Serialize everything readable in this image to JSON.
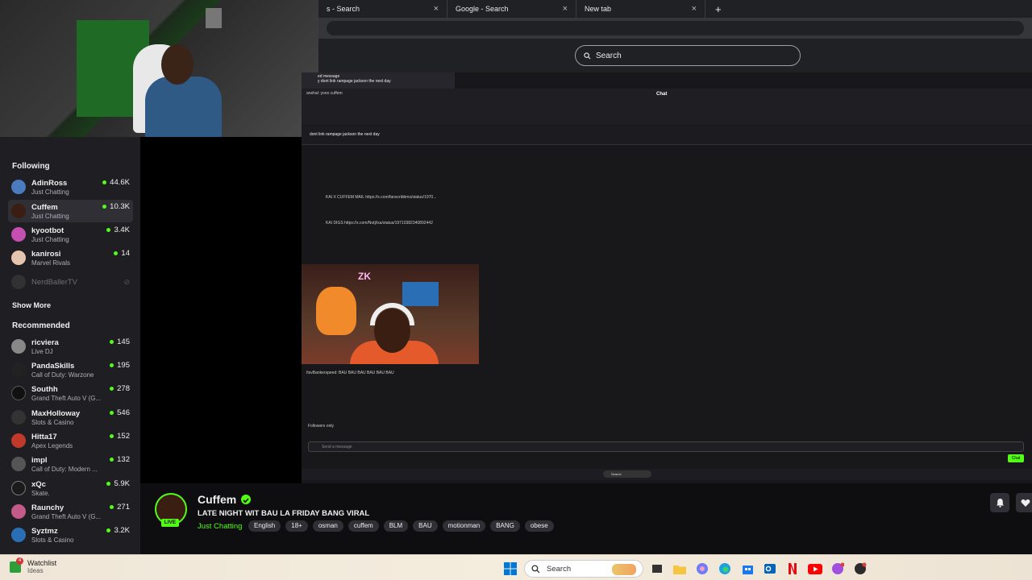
{
  "browser": {
    "tabs": [
      {
        "label": "s - Search",
        "close": "×"
      },
      {
        "label": "Google - Search",
        "close": "×"
      },
      {
        "label": "New tab",
        "close": "×"
      }
    ],
    "new_tab": "+",
    "search_placeholder": "Search"
  },
  "captured": {
    "chat_title": "Chat",
    "pinned": "ed message",
    "pinned_msg": "y dont link rampage jackson the next day",
    "header_msg": "dont link rampage jackson the next day",
    "lines": [
      "arwhal: yooo cuffem",
      "KAI X CUFFEM MAIL https://x.com/fanscribbms/status/1970...",
      "KAI DIGS https://x.com/Notj/ixa/status/19710382340892442",
      "ItsvBankerspeed: BAU BAU BAU BAU BAU BAU",
      "Followers only"
    ],
    "input_placeholder": "Send a message",
    "chat_button": "Chat",
    "neon": "ZK",
    "taskbar_search": "Search"
  },
  "sidebar": {
    "following_title": "Following",
    "following": [
      {
        "name": "AdinRoss",
        "game": "Just Chatting",
        "count": "44.6K",
        "color": "#4a7bbf"
      },
      {
        "name": "Cuffem",
        "game": "Just Chatting",
        "count": "10.3K",
        "color": "#3b1e12"
      },
      {
        "name": "kyootbot",
        "game": "Just Chatting",
        "count": "3.4K",
        "color": "#c44fb0"
      },
      {
        "name": "kanirosi",
        "game": "Marvel Rivals",
        "count": "14",
        "color": "#e5c5b0"
      }
    ],
    "offline": {
      "name": "NerdBallerTV"
    },
    "show_more": "Show More",
    "recommended_title": "Recommended",
    "recommended": [
      {
        "name": "ricviera",
        "game": "Live DJ",
        "count": "145",
        "color": "#888"
      },
      {
        "name": "PandaSkills",
        "game": "Call of Duty: Warzone",
        "count": "195",
        "color": "#222"
      },
      {
        "name": "Southh",
        "game": "Grand Theft Auto V (G...",
        "count": "278",
        "color": "#111"
      },
      {
        "name": "MaxHolloway",
        "game": "Slots & Casino",
        "count": "546",
        "color": "#333"
      },
      {
        "name": "Hitta17",
        "game": "Apex Legends",
        "count": "152",
        "color": "#c0392b"
      },
      {
        "name": "impl",
        "game": "Call of Duty: Modern ...",
        "count": "132",
        "color": "#555"
      },
      {
        "name": "xQc",
        "game": "Skate.",
        "count": "5.9K",
        "color": "#1a1a1a"
      },
      {
        "name": "Raunchy",
        "game": "Grand Theft Auto V (G...",
        "count": "271",
        "color": "#c45a8a"
      },
      {
        "name": "Syztmz",
        "game": "Slots & Casino",
        "count": "3.2K",
        "color": "#2a6fb5"
      }
    ]
  },
  "stream": {
    "streamer": "Cuffem",
    "live": "LIVE",
    "title": "LATE NIGHT WIT BAU LA FRIDAY BANG VIRAL",
    "category": "Just Chatting",
    "tags": [
      "English",
      "18+",
      "osman",
      "cuffem",
      "BLM",
      "BAU",
      "motionman",
      "BANG",
      "obese"
    ]
  },
  "taskbar": {
    "watchlist_title": "Watchlist",
    "watchlist_sub": "Ideas",
    "badge": "4",
    "search": "Search"
  },
  "colors": {
    "accent": "#53fc18",
    "sidebar_bg": "#1f1f23",
    "page_bg": "#0e0e10"
  }
}
